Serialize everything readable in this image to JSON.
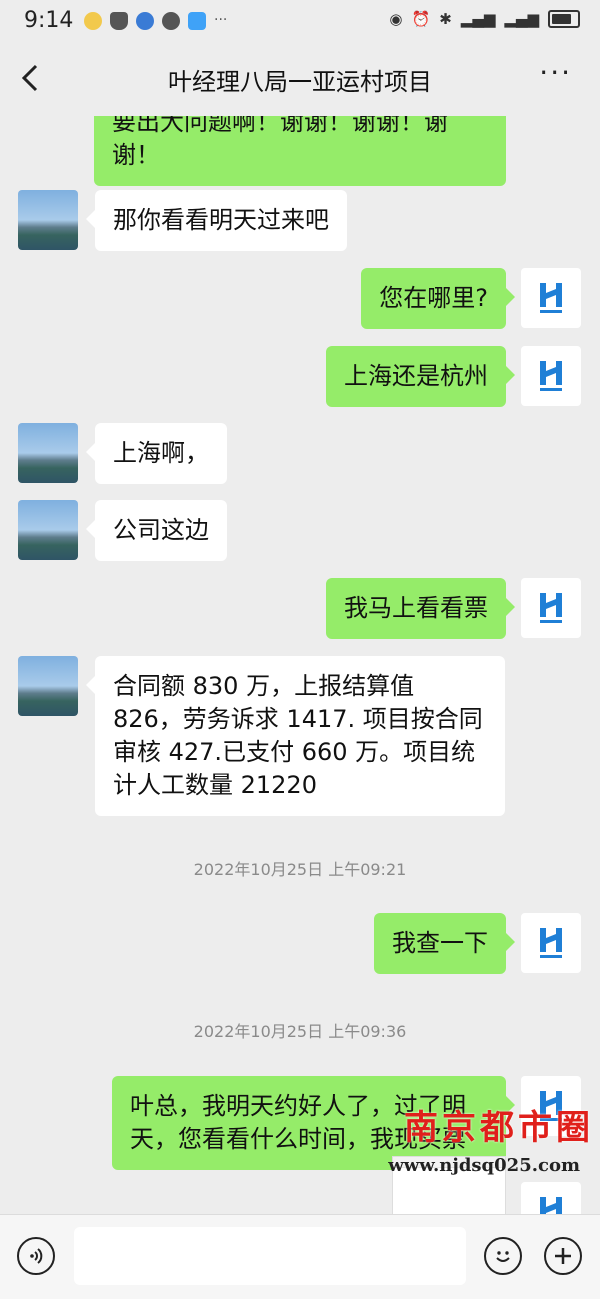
{
  "status": {
    "time": "9:14"
  },
  "header": {
    "title": "叶经理八局一亚运村项目"
  },
  "messages": [
    {
      "side": "out",
      "text": "要出大问题啊！谢谢！谢谢！谢谢！"
    },
    {
      "side": "in",
      "text": "那你看看明天过来吧"
    },
    {
      "side": "out",
      "text": "您在哪里?"
    },
    {
      "side": "out",
      "text": "上海还是杭州"
    },
    {
      "side": "in",
      "text": "上海啊，"
    },
    {
      "side": "in",
      "text": "公司这边"
    },
    {
      "side": "out",
      "text": "我马上看看票"
    },
    {
      "side": "in",
      "text": "合同额 830 万，上报结算值 826，劳务诉求 1417. 项目按合同审核 427.已支付 660 万。项目统计人工数量 21220"
    },
    {
      "type": "timestamp",
      "text": "2022年10月25日 上午09:21"
    },
    {
      "side": "out",
      "text": "我查一下"
    },
    {
      "type": "timestamp",
      "text": "2022年10月25日 上午09:36"
    },
    {
      "side": "out",
      "text": "叶总，我明天约好人了，过了明天，您看看什么时间，我现买票"
    }
  ],
  "watermark": {
    "name": "南京都市圈",
    "url": "www.njdsq025.com"
  },
  "icons": {
    "back": "chevron-left-icon",
    "more": "more-icon",
    "voice": "voice-icon",
    "emoji": "emoji-icon",
    "add": "add-icon"
  },
  "colors": {
    "outgoing_bubble": "#95ec69",
    "incoming_bubble": "#ffffff",
    "background": "#ededed"
  }
}
